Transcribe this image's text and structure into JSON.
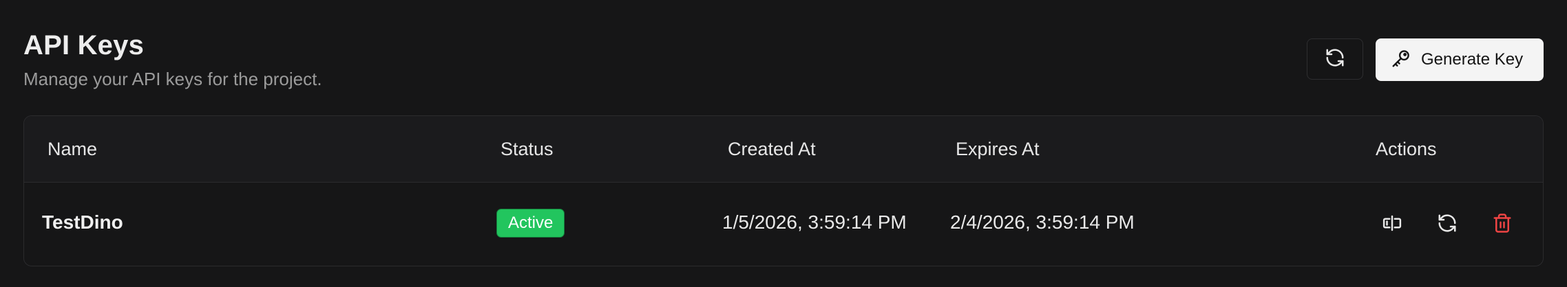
{
  "header": {
    "title": "API Keys",
    "subtitle": "Manage your API keys for the project.",
    "refresh_icon": "refresh-icon",
    "generate_label": "Generate Key",
    "generate_icon": "key-icon"
  },
  "table": {
    "columns": [
      "Name",
      "Status",
      "Created At",
      "Expires At",
      "Actions"
    ],
    "rows": [
      {
        "name": "TestDino",
        "status": "Active",
        "created_at": "1/5/2026, 3:59:14 PM",
        "expires_at": "2/4/2026, 3:59:14 PM",
        "actions": [
          "toggle-visibility-icon",
          "rotate-key-icon",
          "trash-icon"
        ]
      }
    ]
  },
  "colors": {
    "background": "#161617",
    "status_active": "#22c55e",
    "danger": "#ef4444"
  }
}
